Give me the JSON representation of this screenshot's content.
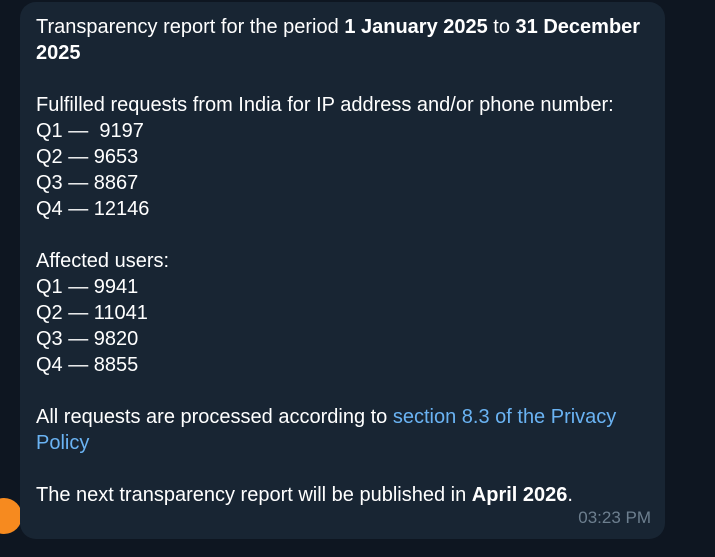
{
  "message": {
    "header": {
      "prefix": "Transparency report for the period ",
      "start_date": "1 January 2025",
      "middle": " to ",
      "end_date": "31 December 2025"
    },
    "fulfilled_section": {
      "title": "Fulfilled requests from India for IP address and/or phone number:",
      "rows": [
        "Q1 —  9197",
        "Q2 — 9653",
        "Q3 — 8867",
        "Q4 — 12146"
      ]
    },
    "affected_section": {
      "title": "Affected users:",
      "rows": [
        "Q1 — 9941",
        "Q2 — 11041",
        "Q3 — 9820",
        "Q4 — 8855"
      ]
    },
    "policy": {
      "prefix": "All requests are processed according to ",
      "link_text": "section 8.3 of the Privacy Policy"
    },
    "next_report": {
      "prefix": "The next transparency report will be published in ",
      "date": "April 2026",
      "suffix": "."
    },
    "timestamp": "03:23 PM"
  },
  "colors": {
    "background": "#0e1621",
    "bubble": "#182533",
    "link": "#6ab3f3",
    "timestamp": "#6d7f8f",
    "avatar": "#f68a1f"
  }
}
